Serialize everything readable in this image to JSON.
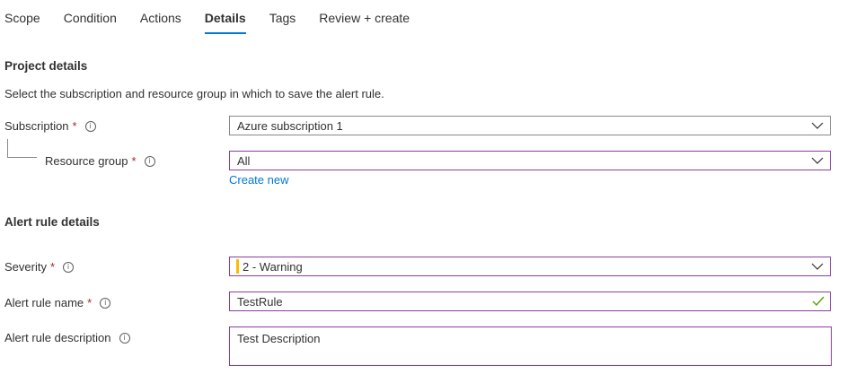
{
  "tabs": [
    {
      "label": "Scope"
    },
    {
      "label": "Condition"
    },
    {
      "label": "Actions"
    },
    {
      "label": "Details",
      "active": true
    },
    {
      "label": "Tags"
    },
    {
      "label": "Review + create"
    }
  ],
  "project": {
    "title": "Project details",
    "description": "Select the subscription and resource group in which to save the alert rule.",
    "subscription_label": "Subscription",
    "subscription_value": "Azure subscription 1",
    "resource_group_label": "Resource group",
    "resource_group_value": "All",
    "create_new": "Create new"
  },
  "alert": {
    "title": "Alert rule details",
    "severity_label": "Severity",
    "severity_value": "2 - Warning",
    "severity_color": "#ffb900",
    "name_label": "Alert rule name",
    "name_value": "TestRule",
    "description_label": "Alert rule description",
    "description_value": "Test Description"
  },
  "common": {
    "required_mark": "*",
    "info_glyph": "i"
  },
  "colors": {
    "accent": "#0078d4",
    "focus_border": "#8a3e9f",
    "required": "#a4262c",
    "valid": "#57a300"
  }
}
